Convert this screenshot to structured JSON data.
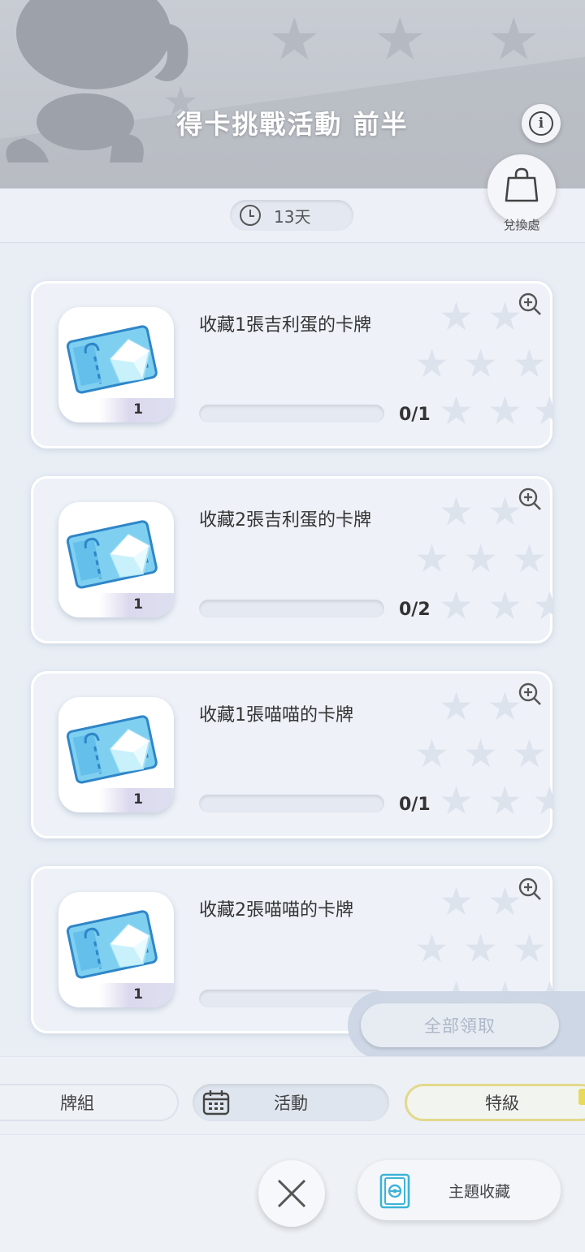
{
  "header": {
    "title": "得卡挑戰活動 前半",
    "info_icon": "info-icon"
  },
  "timer": {
    "icon": "clock-icon",
    "remaining": "13天"
  },
  "shop": {
    "icon": "shopping-bag-icon",
    "label": "兌換處"
  },
  "missions": [
    {
      "text": "收藏1張吉利蛋的卡牌",
      "progress_text": "0/1",
      "progress": 0,
      "reward_qty": "1"
    },
    {
      "text": "收藏2張吉利蛋的卡牌",
      "progress_text": "0/2",
      "progress": 0,
      "reward_qty": "1"
    },
    {
      "text": "收藏1張喵喵的卡牌",
      "progress_text": "0/1",
      "progress": 0,
      "reward_qty": "1"
    },
    {
      "text": "收藏2張喵喵的卡牌",
      "progress_text": "",
      "progress": 0,
      "reward_qty": "1"
    }
  ],
  "claim_all": {
    "label": "全部領取",
    "enabled": false
  },
  "tabs": [
    {
      "label": "牌組"
    },
    {
      "label": "活動",
      "icon": "calendar-icon",
      "selected": true
    },
    {
      "label": "特級"
    }
  ],
  "bottom_nav": {
    "close_icon": "close-icon",
    "theme_collection": "主題收藏",
    "theme_icon": "binder-icon"
  },
  "colors": {
    "progress_fill": "#7cc8ee",
    "premium_border": "#e2d98a",
    "header_bg": "#c8ccd3"
  }
}
